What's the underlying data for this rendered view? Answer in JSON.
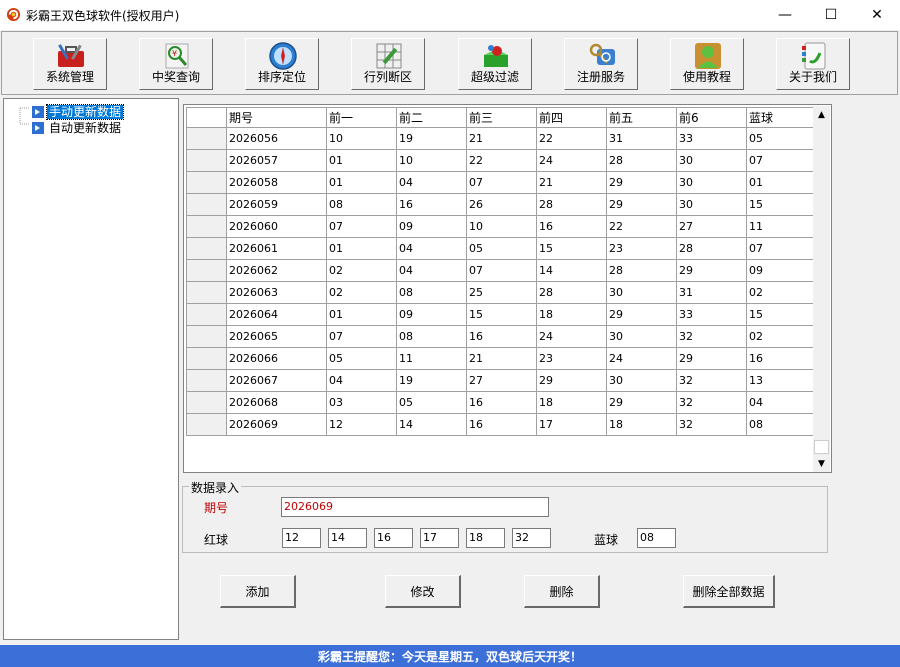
{
  "window": {
    "title": "彩霸王双色球软件(授权用户)",
    "min_glyph": "—",
    "max_glyph": "☐",
    "close_glyph": "✕"
  },
  "toolbar": {
    "buttons": [
      {
        "label": "系统管理",
        "icon": "toolbox-icon"
      },
      {
        "label": "中奖查询",
        "icon": "lottery-search-icon"
      },
      {
        "label": "排序定位",
        "icon": "compass-icon"
      },
      {
        "label": "行列断区",
        "icon": "grid-edit-icon"
      },
      {
        "label": "超级过滤",
        "icon": "filter-icon"
      },
      {
        "label": "注册服务",
        "icon": "keys-icon"
      },
      {
        "label": "使用教程",
        "icon": "user-tutorial-icon"
      },
      {
        "label": "关于我们",
        "icon": "phone-contact-icon"
      }
    ]
  },
  "tree": {
    "items": [
      {
        "label": "手动更新数据",
        "selected": true
      },
      {
        "label": "自动更新数据",
        "selected": false
      }
    ]
  },
  "grid": {
    "columns": [
      "期号",
      "前一",
      "前二",
      "前三",
      "前四",
      "前五",
      "前6",
      "蓝球"
    ],
    "rows": [
      [
        "2026056",
        "10",
        "19",
        "21",
        "22",
        "31",
        "33",
        "05"
      ],
      [
        "2026057",
        "01",
        "10",
        "22",
        "24",
        "28",
        "30",
        "07"
      ],
      [
        "2026058",
        "01",
        "04",
        "07",
        "21",
        "29",
        "30",
        "01"
      ],
      [
        "2026059",
        "08",
        "16",
        "26",
        "28",
        "29",
        "30",
        "15"
      ],
      [
        "2026060",
        "07",
        "09",
        "10",
        "16",
        "22",
        "27",
        "11"
      ],
      [
        "2026061",
        "01",
        "04",
        "05",
        "15",
        "23",
        "28",
        "07"
      ],
      [
        "2026062",
        "02",
        "04",
        "07",
        "14",
        "28",
        "29",
        "09"
      ],
      [
        "2026063",
        "02",
        "08",
        "25",
        "28",
        "30",
        "31",
        "02"
      ],
      [
        "2026064",
        "01",
        "09",
        "15",
        "18",
        "29",
        "33",
        "15"
      ],
      [
        "2026065",
        "07",
        "08",
        "16",
        "24",
        "30",
        "32",
        "02"
      ],
      [
        "2026066",
        "05",
        "11",
        "21",
        "23",
        "24",
        "29",
        "16"
      ],
      [
        "2026067",
        "04",
        "19",
        "27",
        "29",
        "30",
        "32",
        "13"
      ],
      [
        "2026068",
        "03",
        "05",
        "16",
        "18",
        "29",
        "32",
        "04"
      ],
      [
        "2026069",
        "12",
        "14",
        "16",
        "17",
        "18",
        "32",
        "08"
      ]
    ]
  },
  "entry": {
    "group_title": "数据录入",
    "period_label": "期号",
    "period_value": "2026069",
    "red_label": "红球",
    "red_values": [
      "12",
      "14",
      "16",
      "17",
      "18",
      "32"
    ],
    "blue_label": "蓝球",
    "blue_value": "08"
  },
  "actions": {
    "add": "添加",
    "modify": "修改",
    "delete": "删除",
    "delete_all": "删除全部数据"
  },
  "status": {
    "message": "彩霸王提醒您：今天是星期五，双色球后天开奖！"
  },
  "colors": {
    "status_bg": "#3c6fd8",
    "selection": "#0078d7",
    "label_red": "#c00000"
  }
}
